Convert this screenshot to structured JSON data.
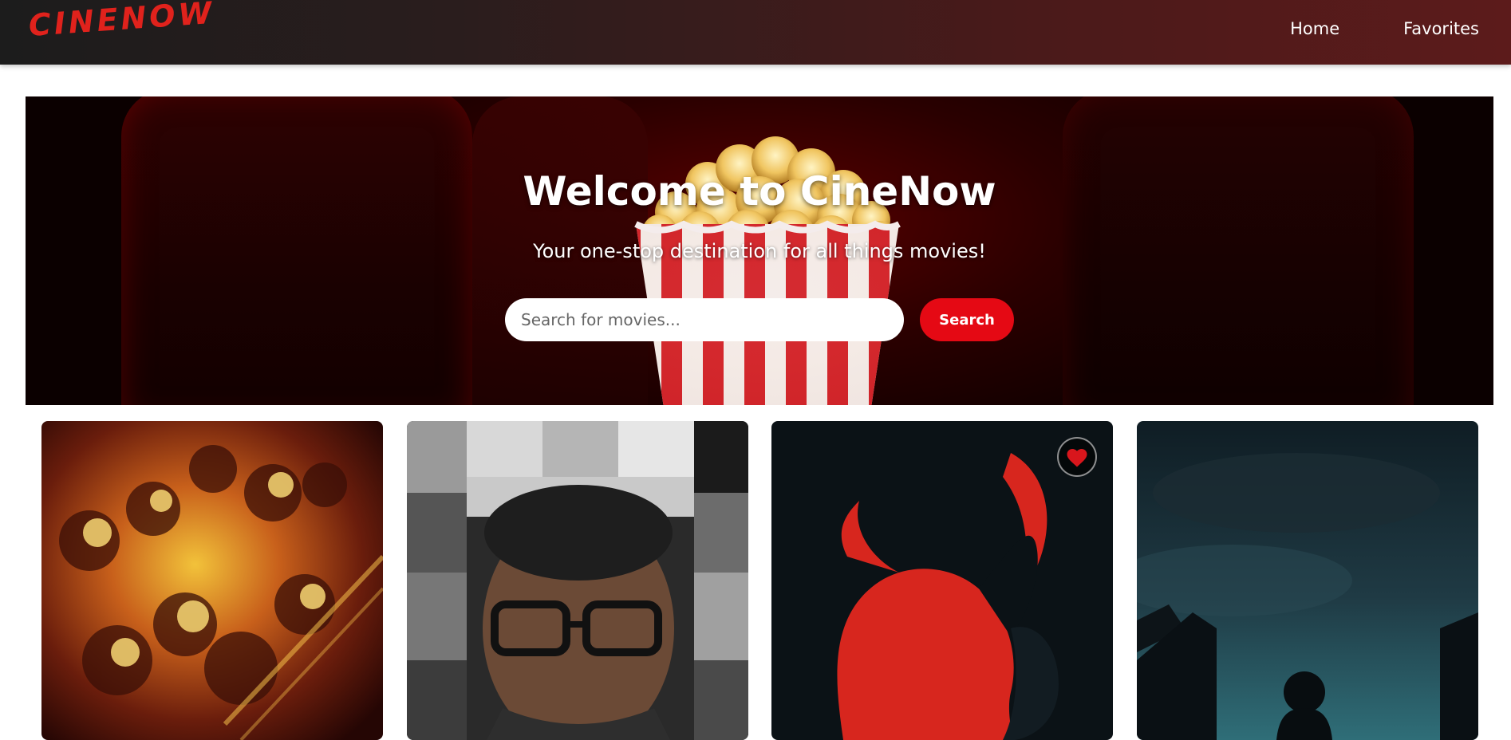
{
  "header": {
    "logo": "CINENOW",
    "nav": [
      "Home",
      "Favorites"
    ]
  },
  "hero": {
    "title": "Welcome to CineNow",
    "subtitle": "Your one-stop destination for all things movies!",
    "search": {
      "placeholder": "Search for movies...",
      "value": ""
    },
    "search_button": "Search"
  },
  "movies": [
    {
      "poster": "anime-poster",
      "favorited": false
    },
    {
      "poster": "collage-poster",
      "favorited": false
    },
    {
      "poster": "devil-silhouette-poster",
      "favorited": true
    },
    {
      "poster": "dark-sky-poster",
      "favorited": false
    }
  ],
  "colors": {
    "accent": "#e50914",
    "logo": "#e0221c",
    "heart": "#d8161c"
  }
}
